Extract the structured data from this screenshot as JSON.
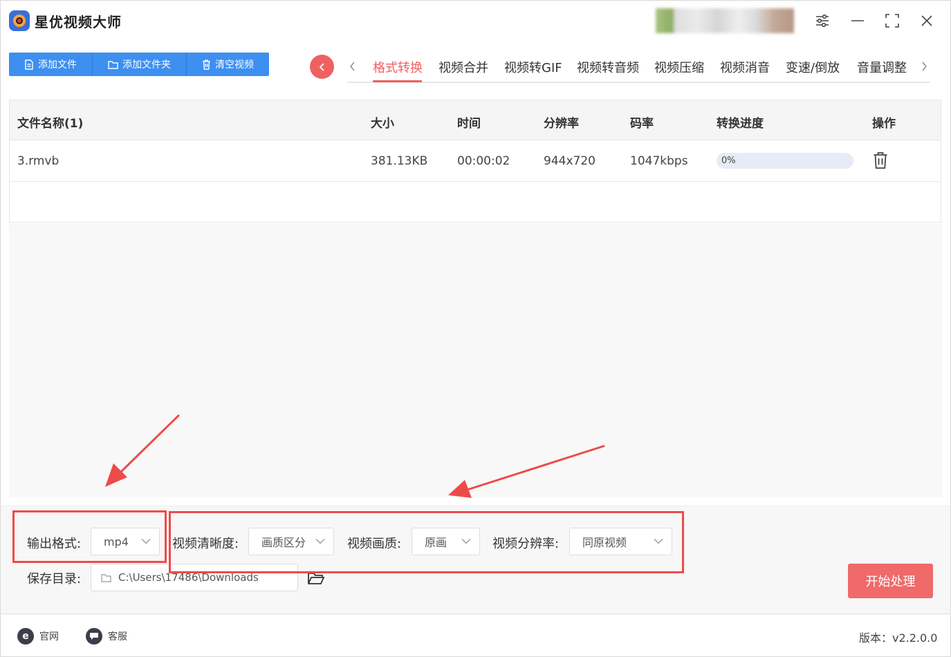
{
  "app": {
    "title": "星优视频大师"
  },
  "toolbar": {
    "buttons": [
      {
        "label": "添加文件",
        "icon": "file-icon"
      },
      {
        "label": "添加文件夹",
        "icon": "folder-icon"
      },
      {
        "label": "清空视频",
        "icon": "trash-icon"
      }
    ]
  },
  "tabs": [
    {
      "label": "格式转换",
      "active": true
    },
    {
      "label": "视频合并"
    },
    {
      "label": "视频转GIF"
    },
    {
      "label": "视频转音频"
    },
    {
      "label": "视频压缩"
    },
    {
      "label": "视频消音"
    },
    {
      "label": "变速/倒放"
    },
    {
      "label": "音量调整"
    }
  ],
  "table": {
    "headers": [
      "文件名称(1)",
      "大小",
      "时间",
      "分辨率",
      "码率",
      "转换进度",
      "操作"
    ],
    "rows": [
      {
        "name": "3.rmvb",
        "size": "381.13KB",
        "time": "00:00:02",
        "resolution": "944x720",
        "bitrate": "1047kbps",
        "progress_text": "0%",
        "progress": 0
      }
    ]
  },
  "settings": {
    "output_format": {
      "label": "输出格式:",
      "value": "mp4"
    },
    "clarity": {
      "label": "视频清晰度:",
      "value": "画质区分"
    },
    "quality": {
      "label": "视频画质:",
      "value": "原画"
    },
    "resolution": {
      "label": "视频分辨率:",
      "value": "同原视频"
    },
    "save_dir": {
      "label": "保存目录:",
      "value": "C:\\Users\\17486\\Downloads"
    },
    "start_button": "开始处理"
  },
  "footer": {
    "website": "官网",
    "support": "客服",
    "version": "版本：v2.2.0.0"
  },
  "colors": {
    "primary": "#3d8ff0",
    "accent": "#ef5f5f",
    "annotation": "#ef4a4a"
  }
}
